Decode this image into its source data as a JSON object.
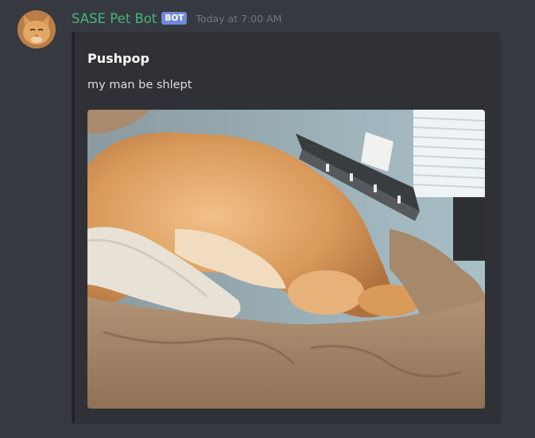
{
  "message": {
    "author": "SASE Pet Bot",
    "bot_tag": "BOT",
    "timestamp": "Today at 7:00 AM"
  },
  "embed": {
    "title": "Pushpop",
    "description": "my man be shlept",
    "image_subject": "orange-cat-sleeping-photo"
  },
  "colors": {
    "background": "#36393f",
    "embed_background": "#2f3136",
    "username": "#43b581",
    "bot_tag": "#7289da",
    "timestamp": "#72767d"
  }
}
